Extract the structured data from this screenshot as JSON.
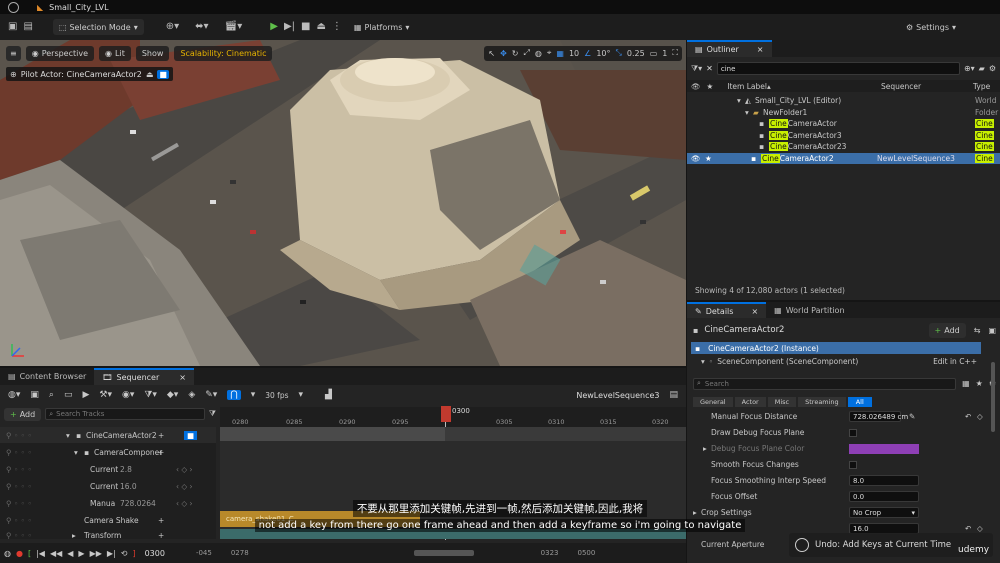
{
  "titlebar": {
    "level_name": "Small_City_LVL"
  },
  "toolbar": {
    "mode_label": "Selection Mode",
    "platforms_label": "Platforms",
    "settings_label": "Settings"
  },
  "viewport": {
    "perspective_label": "Perspective",
    "lit_label": "Lit",
    "show_label": "Show",
    "scalability_label": "Scalability: Cinematic",
    "grid_snap": "10",
    "rot_snap": "10°",
    "scale_snap": "0.25",
    "cam_speed": "1",
    "pilot_label": "Pilot Actor: CineCameraActor2"
  },
  "outliner": {
    "tab_label": "Outliner",
    "search_value": "cine",
    "col_label": "Item Label",
    "col_sequencer": "Sequencer",
    "col_type": "Type",
    "rows": [
      {
        "label": "Small_City_LVL (Editor)",
        "hl": "",
        "seq": "",
        "type": "World"
      },
      {
        "label": "NewFolder1",
        "hl": "",
        "seq": "",
        "type": "Folder"
      },
      {
        "label": "CameraActor",
        "hl": "Cine",
        "seq": "",
        "type": "Cine"
      },
      {
        "label": "CameraActor3",
        "hl": "Cine",
        "seq": "",
        "type": "Cine"
      },
      {
        "label": "CameraActor23",
        "hl": "Cine",
        "seq": "",
        "type": "Cine"
      },
      {
        "label": "CameraActor2",
        "hl": "Cine",
        "seq": "NewLevelSequence3",
        "type": "Cine"
      }
    ],
    "status": "Showing 4 of 12,080 actors (1 selected)"
  },
  "details": {
    "tab_label": "Details",
    "tab2_label": "World Partition",
    "actor_name": "CineCameraActor2",
    "add_label": "Add",
    "instance_label": "CineCameraActor2 (Instance)",
    "component_label": "SceneComponent (SceneComponent)",
    "edit_cpp": "Edit in C++",
    "search_placeholder": "Search",
    "filters": [
      "General",
      "Actor",
      "Misc",
      "Streaming",
      "All"
    ],
    "props": [
      {
        "name": "Manual Focus Distance",
        "value": "728.026489 cm",
        "kind": "field"
      },
      {
        "name": "Draw Debug Focus Plane",
        "value": "",
        "kind": "check"
      },
      {
        "name": "Debug Focus Plane Color",
        "value": "",
        "kind": "color"
      },
      {
        "name": "Smooth Focus Changes",
        "value": "",
        "kind": "check"
      },
      {
        "name": "Focus Smoothing Interp Speed",
        "value": "8.0",
        "kind": "field"
      },
      {
        "name": "Focus Offset",
        "value": "0.0",
        "kind": "field"
      },
      {
        "name": "Crop Settings",
        "value": "No Crop",
        "kind": "select"
      },
      {
        "name": "",
        "value": "16.0",
        "kind": "field"
      },
      {
        "name": "Current Aperture",
        "value": "",
        "kind": "none"
      }
    ]
  },
  "bottom_tabs": {
    "content_browser": "Content Browser",
    "sequencer": "Sequencer"
  },
  "sequencer": {
    "fps_label": "30 fps",
    "sequence_name": "NewLevelSequence3",
    "add_label": "Add",
    "search_placeholder": "Search Tracks",
    "current_frame": "0300",
    "ticks": [
      "0280",
      "0285",
      "0290",
      "0295",
      "0305",
      "0310",
      "0315",
      "0320"
    ],
    "tracks": [
      {
        "name": "CineCameraActor2",
        "value": ""
      },
      {
        "name": "CameraComponer",
        "value": ""
      },
      {
        "name": "Current",
        "value": "2.8"
      },
      {
        "name": "Current",
        "value": "16.0"
      },
      {
        "name": "Manua",
        "value": "728.0264"
      },
      {
        "name": "Camera Shake",
        "value": ""
      },
      {
        "name": "Transform",
        "value": ""
      }
    ],
    "shake_clip_label": "camera_shake01_C",
    "play_frame": "0300",
    "range_start": "-045",
    "range_view_start": "0278",
    "range_view_end": "0323",
    "range_end": "0500"
  },
  "subtitles": {
    "zh": "不要从那里添加关键帧,先进到一帧,然后添加关键帧,因此,我将",
    "en": "not add a key from there go one frame ahead and then add a keyframe so i'm going to navigate"
  },
  "toast": {
    "text": "Undo: Add Keys at Current Time"
  },
  "watermark": {
    "text": "udemy"
  }
}
